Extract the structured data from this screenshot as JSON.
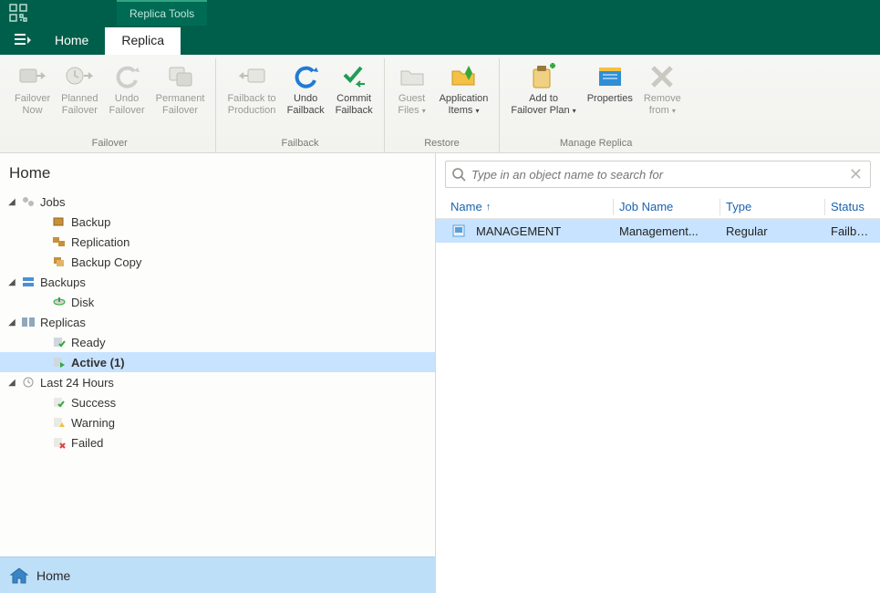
{
  "contextual_tab": "Replica Tools",
  "tabs": {
    "home": "Home",
    "replica": "Replica"
  },
  "ribbon": {
    "groups": {
      "failover": {
        "label": "Failover",
        "buttons": {
          "failover_now": "Failover\nNow",
          "planned_failover": "Planned\nFailover",
          "undo_failover": "Undo\nFailover",
          "permanent_failover": "Permanent\nFailover"
        }
      },
      "failback": {
        "label": "Failback",
        "buttons": {
          "failback_to_production": "Failback to\nProduction",
          "undo_failback": "Undo\nFailback",
          "commit_failback": "Commit\nFailback"
        }
      },
      "restore": {
        "label": "Restore",
        "buttons": {
          "guest_files": "Guest\nFiles ",
          "application_items": "Application\nItems "
        }
      },
      "manage": {
        "label": "Manage Replica",
        "buttons": {
          "add_to_failover_plan": "Add to\nFailover Plan ",
          "properties": "Properties",
          "remove_from": "Remove\nfrom "
        }
      }
    }
  },
  "left": {
    "title": "Home",
    "tree": {
      "jobs": "Jobs",
      "backup": "Backup",
      "replication": "Replication",
      "backup_copy": "Backup Copy",
      "backups": "Backups",
      "disk": "Disk",
      "replicas": "Replicas",
      "ready": "Ready",
      "active": "Active (1)",
      "last24": "Last 24 Hours",
      "success": "Success",
      "warning": "Warning",
      "failed": "Failed"
    },
    "footer": "Home"
  },
  "search": {
    "placeholder": "Type in an object name to search for"
  },
  "grid": {
    "headers": {
      "name": "Name",
      "job": "Job Name",
      "type": "Type",
      "status": "Status"
    },
    "rows": [
      {
        "name": "MANAGEMENT",
        "job": "Management...",
        "type": "Regular",
        "status": "Failback"
      }
    ]
  }
}
